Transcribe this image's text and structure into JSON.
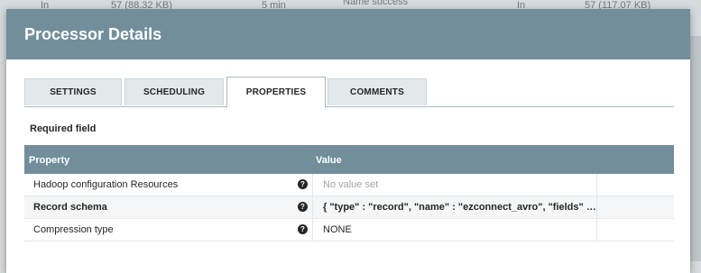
{
  "background": {
    "row_left": "In",
    "row_left_value": "57 (88.32 KB)",
    "row_left_time": "5 min",
    "row_right_name": "Name  success",
    "row_right": "In",
    "row_right_value": "57 (117.07 KB)"
  },
  "dialog": {
    "title": "Processor Details",
    "tabs": [
      {
        "label": "SETTINGS",
        "active": false
      },
      {
        "label": "SCHEDULING",
        "active": false
      },
      {
        "label": "PROPERTIES",
        "active": true
      },
      {
        "label": "COMMENTS",
        "active": false
      }
    ],
    "required_label": "Required field",
    "table": {
      "headers": {
        "property": "Property",
        "value": "Value"
      },
      "rows": [
        {
          "property": "Hadoop configuration Resources",
          "value": "No value set",
          "required": false,
          "empty": true
        },
        {
          "property": "Record schema",
          "value": "{ \"type\" : \"record\", \"name\" : \"ezconnect_avro\", \"fields\" : [ ...",
          "required": true,
          "empty": false
        },
        {
          "property": "Compression type",
          "value": "NONE",
          "required": false,
          "empty": false
        }
      ],
      "help_icon": "question-circle-icon"
    }
  },
  "colors": {
    "header": "#728e9b",
    "tab_inactive": "#e3e8eb",
    "muted_text": "#9aa5ab"
  }
}
